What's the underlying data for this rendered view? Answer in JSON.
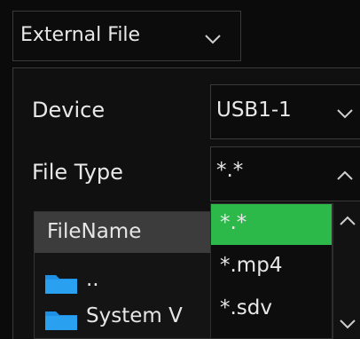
{
  "source": {
    "selected": "External File",
    "chevron_icon": "chevron-down-icon"
  },
  "device": {
    "label": "Device",
    "value": "USB1-1",
    "chevron_icon": "chevron-down-icon"
  },
  "file_type": {
    "label": "File Type",
    "value": "*.*",
    "chevron_icon": "chevron-up-icon",
    "options": [
      "*.*",
      "*.mp4",
      "*.sdv"
    ],
    "highlighted_index": 0
  },
  "file_list": {
    "column_header": "FileName",
    "rows": [
      {
        "name": "..",
        "icon": "folder-icon"
      },
      {
        "name": "System V",
        "icon": "folder-icon"
      }
    ]
  },
  "colors": {
    "background": "#0b0b0b",
    "highlight": "#2db84a",
    "folder": "#1e90e6",
    "header": "#3c3c3c"
  }
}
